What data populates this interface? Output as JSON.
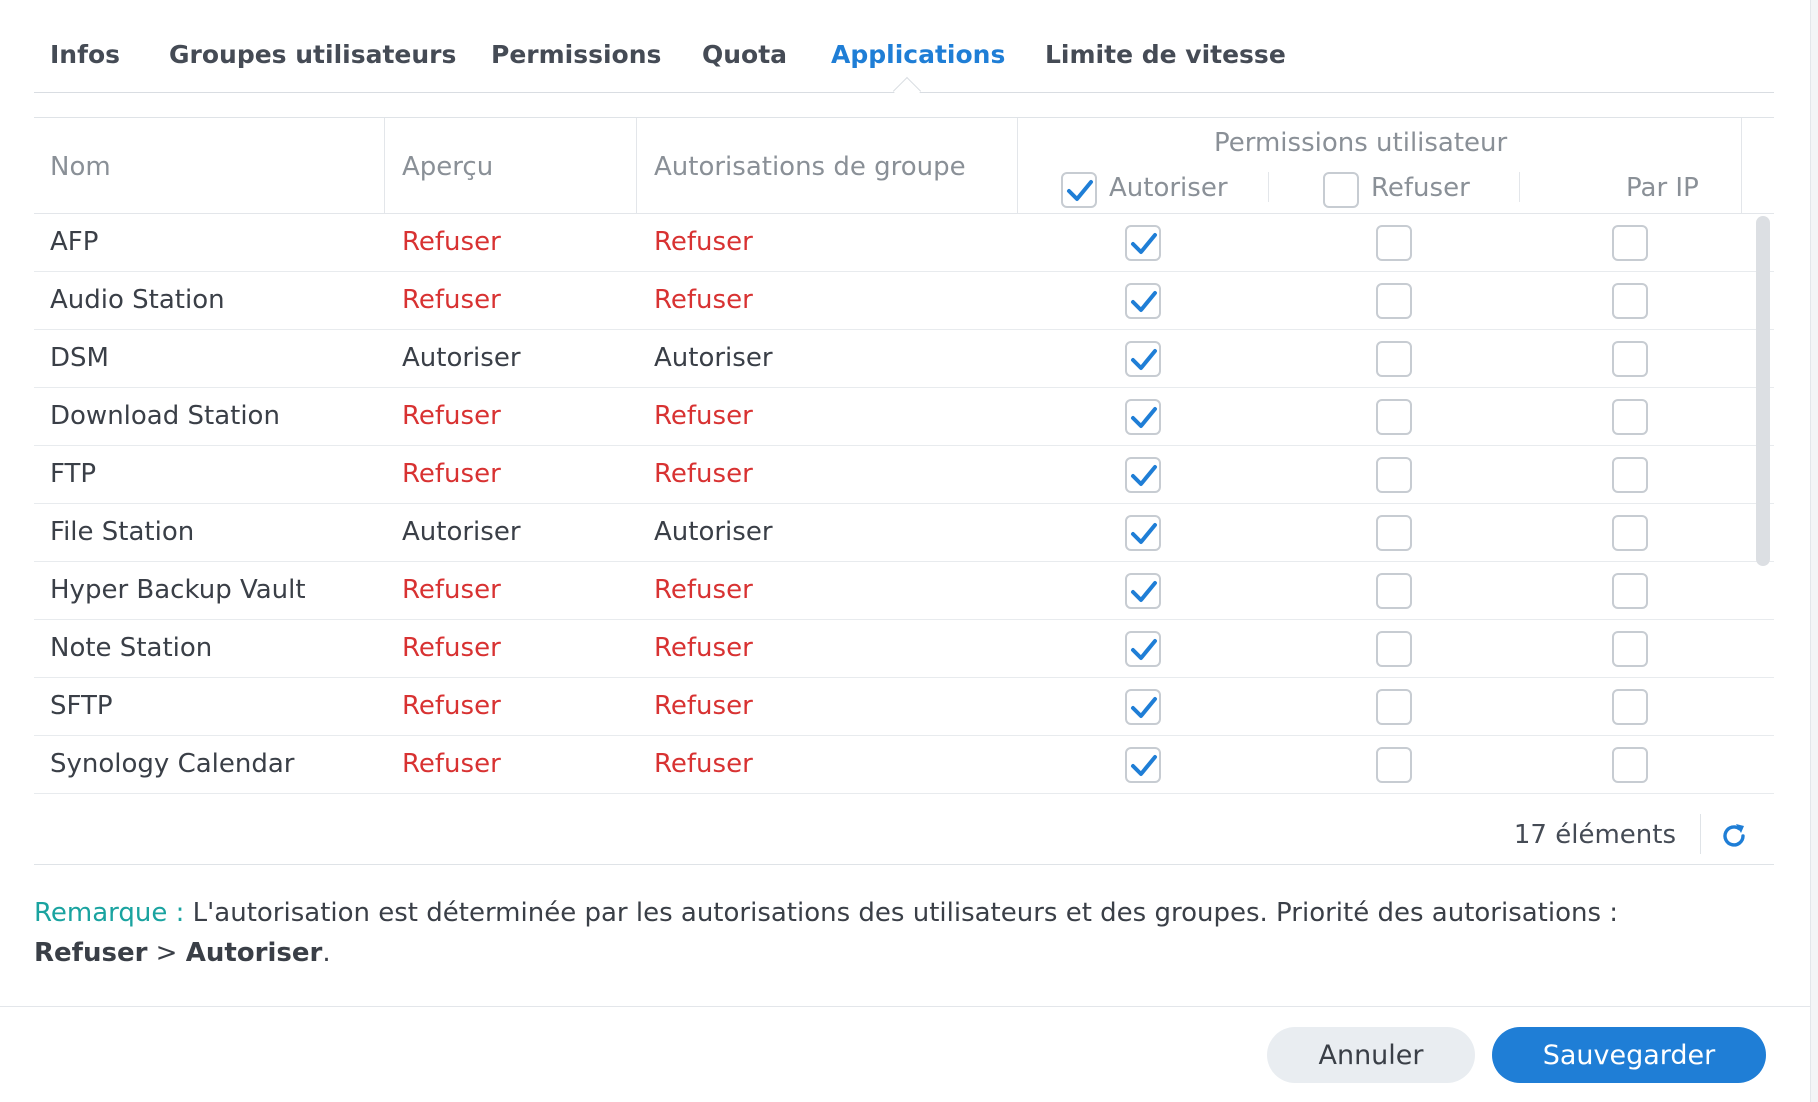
{
  "tabs": [
    {
      "label": "Infos",
      "active": false
    },
    {
      "label": "Groupes utilisateurs",
      "active": false
    },
    {
      "label": "Permissions",
      "active": false
    },
    {
      "label": "Quota",
      "active": false
    },
    {
      "label": "Applications",
      "active": true
    },
    {
      "label": "Limite de vitesse",
      "active": false
    }
  ],
  "table": {
    "col_name": "Nom",
    "col_preview": "Aperçu",
    "col_group": "Autorisations de groupe",
    "col_user_perms": "Permissions utilisateur",
    "sub_allow": "Autoriser",
    "sub_deny": "Refuser",
    "sub_byip": "Par IP",
    "header_allow_checked": true,
    "header_deny_checked": false,
    "rows": [
      {
        "name": "AFP",
        "preview": "Refuser",
        "group": "Refuser",
        "allow": true,
        "deny": false,
        "byip": false
      },
      {
        "name": "Audio Station",
        "preview": "Refuser",
        "group": "Refuser",
        "allow": true,
        "deny": false,
        "byip": false
      },
      {
        "name": "DSM",
        "preview": "Autoriser",
        "group": "Autoriser",
        "allow": true,
        "deny": false,
        "byip": false
      },
      {
        "name": "Download Station",
        "preview": "Refuser",
        "group": "Refuser",
        "allow": true,
        "deny": false,
        "byip": false
      },
      {
        "name": "FTP",
        "preview": "Refuser",
        "group": "Refuser",
        "allow": true,
        "deny": false,
        "byip": false
      },
      {
        "name": "File Station",
        "preview": "Autoriser",
        "group": "Autoriser",
        "allow": true,
        "deny": false,
        "byip": false
      },
      {
        "name": "Hyper Backup Vault",
        "preview": "Refuser",
        "group": "Refuser",
        "allow": true,
        "deny": false,
        "byip": false
      },
      {
        "name": "Note Station",
        "preview": "Refuser",
        "group": "Refuser",
        "allow": true,
        "deny": false,
        "byip": false
      },
      {
        "name": "SFTP",
        "preview": "Refuser",
        "group": "Refuser",
        "allow": true,
        "deny": false,
        "byip": false
      },
      {
        "name": "Synology Calendar",
        "preview": "Refuser",
        "group": "Refuser",
        "allow": true,
        "deny": false,
        "byip": false
      }
    ],
    "count_label": "17 éléments"
  },
  "note": {
    "label": "Remarque :",
    "text": " L'autorisation est déterminée par les autorisations des utilisateurs et des groupes. Priorité des autorisations :",
    "deny": "Refuser",
    "gt": " > ",
    "allow": "Autoriser",
    "end": "."
  },
  "buttons": {
    "cancel": "Annuler",
    "save": "Sauvegarder"
  },
  "colors": {
    "accent": "#1f7ed6",
    "deny": "#d83232",
    "note_label": "#1aa3a0"
  }
}
